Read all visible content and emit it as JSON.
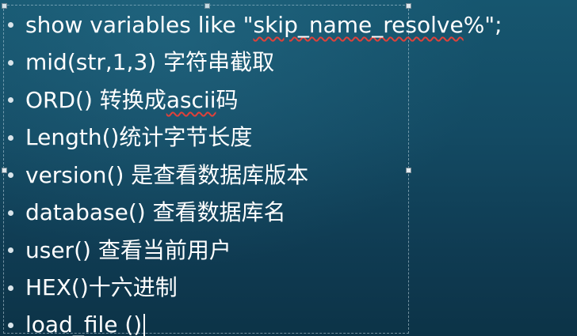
{
  "slide": {
    "bullets": [
      {
        "pre": "show variables like \"",
        "marked": "skip_name_resolve",
        "post": "%\";"
      },
      {
        "pre": "mid(str,1,3) 字符串截取",
        "marked": "",
        "post": ""
      },
      {
        "pre": "ORD() 转换成",
        "marked": "ascii",
        "post": "码"
      },
      {
        "pre": "Length()统计字节长度",
        "marked": "",
        "post": ""
      },
      {
        "pre": "version() 是查看数据库版本",
        "marked": "",
        "post": ""
      },
      {
        "pre": "database() 查看数据库名",
        "marked": "",
        "post": ""
      },
      {
        "pre": "user() 查看当前用户",
        "marked": "",
        "post": ""
      },
      {
        "pre": "HEX()十六进制",
        "marked": "",
        "post": ""
      },
      {
        "pre": "",
        "marked": "load_file",
        "post": " ()"
      }
    ]
  },
  "colors": {
    "background_top": "#16566f",
    "background_bottom": "#0c3347",
    "text": "#ffffff",
    "spellcheck_underline": "#e0413a"
  }
}
